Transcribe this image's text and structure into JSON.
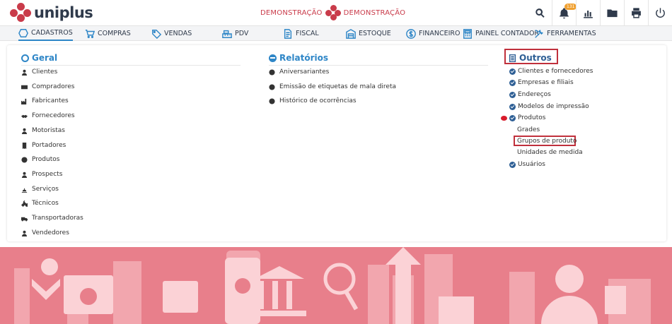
{
  "header": {
    "logo_text": "uniplus",
    "company_left": "DEMONSTRAÇÃO",
    "company_right": "DEMONSTRAÇÃO",
    "notification_count": "131",
    "icons": [
      "search-icon",
      "bell-icon",
      "bar-chart-icon",
      "folder-icon",
      "printer-icon",
      "power-icon"
    ]
  },
  "nav": {
    "items": [
      {
        "label": "CADASTROS",
        "icon": "hexagon-icon"
      },
      {
        "label": "COMPRAS",
        "icon": "cart-icon"
      },
      {
        "label": "VENDAS",
        "icon": "tag-icon"
      },
      {
        "label": "PDV",
        "icon": "register-icon"
      },
      {
        "label": "FISCAL",
        "icon": "document-icon"
      },
      {
        "label": "ESTOQUE",
        "icon": "warehouse-icon"
      },
      {
        "label": "FINANCEIRO",
        "icon": "dollar-icon"
      },
      {
        "label": "PAINEL CONTADOR",
        "icon": "calculator-icon"
      },
      {
        "label": "FERRAMENTAS",
        "icon": "tools-icon"
      }
    ]
  },
  "geral": {
    "title": "Geral",
    "items": [
      "Clientes",
      "Compradores",
      "Fabricantes",
      "Fornecedores",
      "Motoristas",
      "Portadores",
      "Produtos",
      "Prospects",
      "Serviços",
      "Técnicos",
      "Transportadoras",
      "Vendedores"
    ]
  },
  "relatorios": {
    "title": "Relatórios",
    "items": [
      "Aniversariantes",
      "Emissão de etiquetas de mala direta",
      "Histórico de ocorrências"
    ]
  },
  "outros": {
    "title": "Outros",
    "items": [
      "Clientes e fornecedores",
      "Empresas e filiais",
      "Endereços",
      "Modelos de impressão",
      "Produtos",
      "Usuários"
    ],
    "subitems": [
      "Grades",
      "Grupos de produto",
      "Unidades de medida"
    ]
  },
  "colors": {
    "accent": "#2e86c7",
    "brand": "#c93b4a",
    "dark": "#2f3a4b",
    "banner": "#e87f8b",
    "highlight": "#c0303c"
  }
}
